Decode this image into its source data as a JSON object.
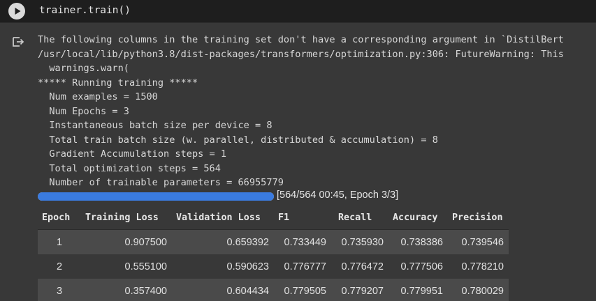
{
  "code_cell": {
    "code": "trainer.train()",
    "run_icon": "play-icon"
  },
  "output": {
    "icon": "output-redirect-icon",
    "log_lines": [
      "The following columns in the training set don't have a corresponding argument in `DistilBert",
      "/usr/local/lib/python3.8/dist-packages/transformers/optimization.py:306: FutureWarning: This",
      "  warnings.warn(",
      "***** Running training *****",
      "  Num examples = 1500",
      "  Num Epochs = 3",
      "  Instantaneous batch size per device = 8",
      "  Total train batch size (w. parallel, distributed & accumulation) = 8",
      "  Gradient Accumulation steps = 1",
      "  Total optimization steps = 564",
      "  Number of trainable parameters = 66955779"
    ],
    "progress": {
      "fraction": 1.0,
      "text": "[564/564 00:45, Epoch 3/3]",
      "fill_color": "#3a7be0"
    },
    "table": {
      "headers": [
        "Epoch",
        "Training Loss",
        "Validation Loss",
        "F1",
        "Recall",
        "Accuracy",
        "Precision"
      ],
      "rows": [
        [
          "1",
          "0.907500",
          "0.659392",
          "0.733449",
          "0.735930",
          "0.738386",
          "0.739546"
        ],
        [
          "2",
          "0.555100",
          "0.590623",
          "0.776777",
          "0.776472",
          "0.777506",
          "0.778210"
        ],
        [
          "3",
          "0.357400",
          "0.604434",
          "0.779505",
          "0.779207",
          "0.779951",
          "0.780029"
        ]
      ]
    }
  }
}
